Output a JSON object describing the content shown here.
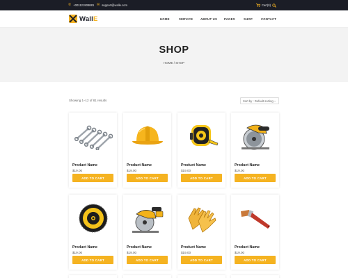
{
  "topbar": {
    "phone": "+001121909881",
    "email": "support@walle.com",
    "cart": "Cart(0)",
    "phone_icon": "phone-icon",
    "email_icon": "envelope-icon",
    "cart_icon": "cart-icon",
    "search_icon": "search-icon"
  },
  "brand": {
    "name_main": "Wall",
    "name_accent": "E"
  },
  "nav": {
    "items": [
      "HOME",
      "SERVICE",
      "ABOUT US",
      "PAGES",
      "SHOP",
      "CONTACT"
    ]
  },
  "hero": {
    "title": "SHOP",
    "breadcrumb": "HOME / SHOP"
  },
  "toolbar": {
    "results": "Showing 1–12 of 81 results",
    "sort_value": "Sort by : Default sorting"
  },
  "products": [
    {
      "name": "Product Name",
      "price": "$19.00",
      "button": "ADD TO CART",
      "icon": "wrench-set-icon"
    },
    {
      "name": "Product Name",
      "price": "$19.00",
      "button": "ADD TO CART",
      "icon": "hard-hat-icon"
    },
    {
      "name": "Product Name",
      "price": "$19.00",
      "button": "ADD TO CART",
      "icon": "tape-measure-icon"
    },
    {
      "name": "Product Name",
      "price": "$19.00",
      "button": "ADD TO CART",
      "icon": "circular-saw-icon"
    },
    {
      "name": "Product Name",
      "price": "$19.00",
      "button": "ADD TO CART",
      "icon": "saw-blade-icon"
    },
    {
      "name": "Product Name",
      "price": "$19.00",
      "button": "ADD TO CART",
      "icon": "cordless-saw-icon"
    },
    {
      "name": "Product Name",
      "price": "$19.00",
      "button": "ADD TO CART",
      "icon": "work-gloves-icon"
    },
    {
      "name": "Product Name",
      "price": "$19.00",
      "button": "ADD TO CART",
      "icon": "paint-brush-icon"
    }
  ],
  "colors": {
    "accent": "#f5b321",
    "dark": "#1b1d26",
    "hero_bg": "#f3f3f3"
  }
}
